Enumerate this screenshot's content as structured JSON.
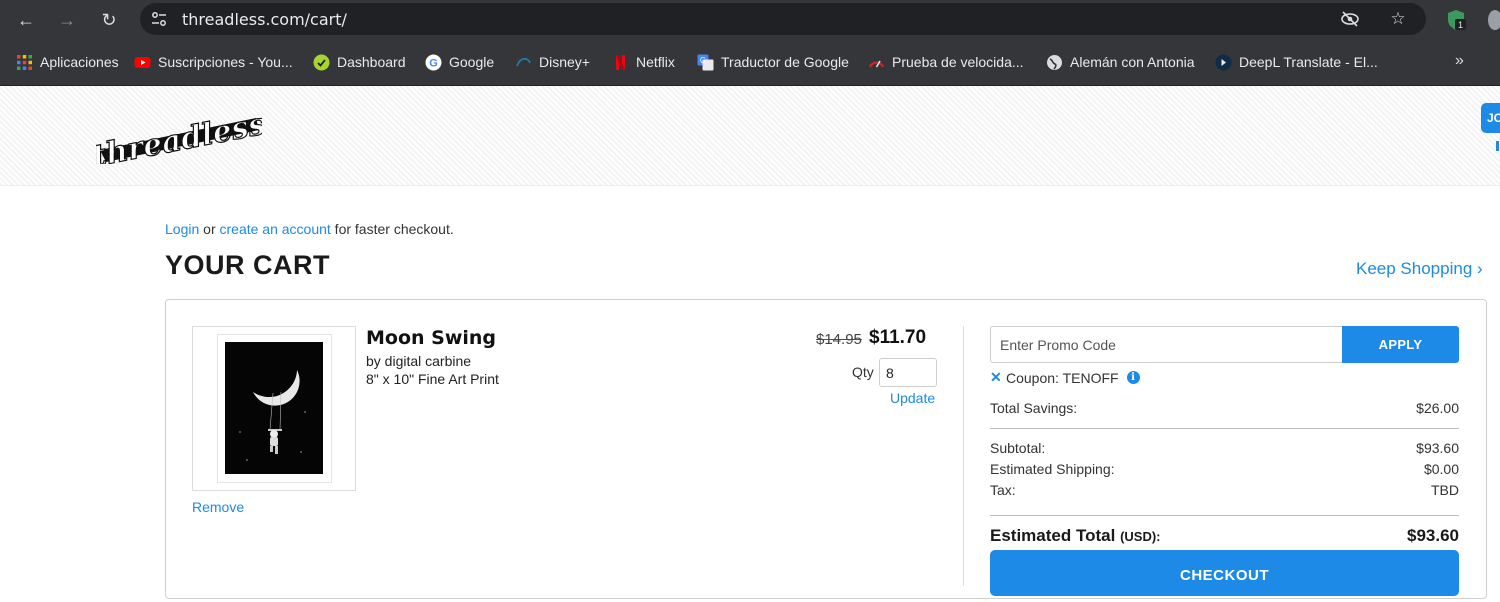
{
  "browser": {
    "url": "threadless.com/cart/",
    "bookmarks": [
      {
        "label": "Aplicaciones",
        "icon": "apps-grid-icon"
      },
      {
        "label": "Suscripciones - You...",
        "icon": "youtube-icon"
      },
      {
        "label": "Dashboard",
        "icon": "dashboard-icon"
      },
      {
        "label": "Google",
        "icon": "google-icon"
      },
      {
        "label": "Disney+",
        "icon": "disney-plus-icon"
      },
      {
        "label": "Netflix",
        "icon": "netflix-icon"
      },
      {
        "label": "Traductor de Google",
        "icon": "google-translate-icon"
      },
      {
        "label": "Prueba de velocida...",
        "icon": "speedtest-icon"
      },
      {
        "label": "Alemán con Antonia",
        "icon": "globe-icon"
      },
      {
        "label": "DeepL Translate - El...",
        "icon": "deepl-icon"
      }
    ],
    "extension_badge": "1"
  },
  "header": {
    "logo_text": "threadless",
    "join_label": "JO"
  },
  "cart": {
    "login_link": "Login",
    "or_text": " or ",
    "create_account_link": "create an account",
    "faster_text": " for faster checkout.",
    "title": "YOUR CART",
    "keep_shopping": "Keep Shopping ›",
    "item": {
      "name": "Moon Swing",
      "artist": "by digital carbine",
      "variant": "8\" x 10\" Fine Art Print",
      "old_price": "$14.95",
      "price": "$11.70",
      "qty_label": "Qty",
      "qty_value": "8",
      "update_label": "Update",
      "remove_label": "Remove"
    },
    "summary": {
      "promo_placeholder": "Enter Promo Code",
      "apply_label": "APPLY",
      "coupon_text": "Coupon: TENOFF",
      "total_savings_label": "Total Savings:",
      "total_savings_value": "$26.00",
      "subtotal_label": "Subtotal:",
      "subtotal_value": "$93.60",
      "shipping_label": "Estimated Shipping:",
      "shipping_value": "$0.00",
      "tax_label": "Tax:",
      "tax_value": "TBD",
      "estimated_total_label": "Estimated Total",
      "currency_label": "(USD):",
      "estimated_total_value": "$93.60",
      "checkout_label": "CHECKOUT"
    }
  },
  "colors": {
    "accent": "#1c8ae6",
    "chrome_bg": "#35363a",
    "omnibox_bg": "#202124"
  }
}
